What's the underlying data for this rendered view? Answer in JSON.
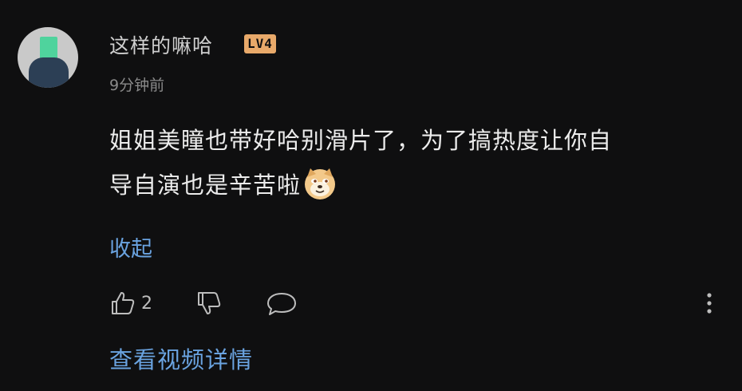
{
  "comment": {
    "user": {
      "name": "这样的嘛哈",
      "level": "LV4",
      "avatar_icon": "user-avatar"
    },
    "timestamp": "9分钟前",
    "content_line1": "姐姐美瞳也带好哈别滑片了，为了搞热度让你自",
    "content_line2": "导自演也是辛苦啦",
    "emoji_icon": "doge-emoji",
    "collapse_label": "收起",
    "actions": {
      "like_count": "2",
      "like_icon": "thumbs-up-icon",
      "dislike_icon": "thumbs-down-icon",
      "reply_icon": "comment-bubble-icon",
      "more_icon": "more-vertical-icon"
    },
    "view_details_label": "查看视频详情"
  },
  "colors": {
    "background": "#0f0f10",
    "text_primary": "#ececec",
    "text_secondary": "#8a8a8a",
    "link": "#6aa3e0",
    "level_badge": "#e8a96a"
  }
}
